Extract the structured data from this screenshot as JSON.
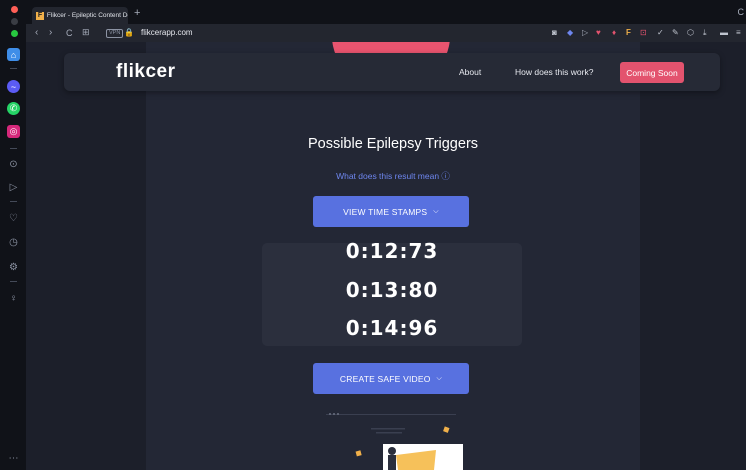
{
  "browser": {
    "tab_title": "Flikcer - Epileptic Content Dete",
    "new_tab": "+",
    "tabbar_right": "C",
    "url": "flikcerapp.com",
    "vpn_label": "VPN",
    "nav": {
      "back": "‹",
      "forward": "›",
      "reload": "C",
      "speed_dial": "⊞"
    }
  },
  "site": {
    "logo": "flikcer",
    "nav": {
      "about": "About",
      "how": "How does this work?",
      "cta": "Coming Soon"
    },
    "result_heading": "Possible Epilepsy Triggers",
    "help_link": "What does this result mean ⓘ",
    "view_button": "VIEW TIME STAMPS",
    "timestamps": [
      "0:12:73",
      "0:13:80",
      "0:14:96"
    ],
    "safe_button": "CREATE SAFE VIDEO",
    "colors": {
      "accent": "#e3536e",
      "primary_button": "#5871e0",
      "link": "#6e86ee",
      "background": "#1c1f2a",
      "panel": "#232735"
    }
  }
}
